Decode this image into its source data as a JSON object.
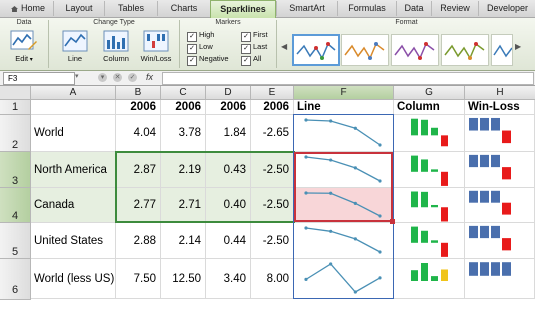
{
  "ribbon_tabs": [
    "Home",
    "Layout",
    "Tables",
    "Charts",
    "Sparklines",
    "SmartArt",
    "Formulas",
    "Data",
    "Review",
    "Developer"
  ],
  "active_tab": "Sparklines",
  "groups": {
    "data": {
      "title": "Data",
      "edit_label": "Edit"
    },
    "change_type": {
      "title": "Change Type",
      "line_label": "Line",
      "column_label": "Column",
      "winloss_label": "Win/Loss"
    },
    "markers": {
      "title": "Markers",
      "checks": [
        {
          "label": "High",
          "checked": true
        },
        {
          "label": "Low",
          "checked": true
        },
        {
          "label": "Negative",
          "checked": true
        },
        {
          "label": "First",
          "checked": true
        },
        {
          "label": "Last",
          "checked": true
        },
        {
          "label": "All",
          "checked": true
        }
      ]
    },
    "format": {
      "title": "Format"
    }
  },
  "formula_bar": {
    "cell_ref": "F3",
    "fx": "fx",
    "content": ""
  },
  "columns": [
    "A",
    "B",
    "C",
    "D",
    "E",
    "F",
    "G",
    "H"
  ],
  "selected_column": "F",
  "rows": [
    "1",
    "2",
    "3",
    "4",
    "5",
    "6"
  ],
  "selected_rows": [
    "3",
    "4"
  ],
  "header_row": {
    "a": "",
    "b": "2006",
    "c": "2006",
    "d": "2006",
    "e": "2006",
    "f": "Line",
    "g": "Column",
    "h": "Win-Loss"
  },
  "data_rows": [
    {
      "label": "World",
      "b": "4.04",
      "c": "3.78",
      "d": "1.84",
      "e": "-2.65"
    },
    {
      "label": "North America",
      "b": "2.87",
      "c": "2.19",
      "d": "0.43",
      "e": "-2.50"
    },
    {
      "label": "Canada",
      "b": "2.77",
      "c": "2.71",
      "d": "0.40",
      "e": "-2.50"
    },
    {
      "label": "United States",
      "b": "2.88",
      "c": "2.14",
      "d": "0.44",
      "e": "-2.50"
    },
    {
      "label": "World (less US)",
      "b": "7.50",
      "c": "12.50",
      "d": "3.40",
      "e": "8.00"
    }
  ],
  "sparkline_values": [
    [
      4.04,
      3.78,
      1.84,
      -2.65
    ],
    [
      2.87,
      2.19,
      0.43,
      -2.5
    ],
    [
      2.77,
      2.71,
      0.4,
      -2.5
    ],
    [
      2.88,
      2.14,
      0.44,
      -2.5
    ],
    [
      7.5,
      12.5,
      3.4,
      8.0
    ]
  ],
  "colors": {
    "line": "#4a90b5",
    "column_positive": "#1fb54a",
    "column_negative": "#e81a1a",
    "column_highlight": "#f0c419",
    "winloss_positive": "#4a6fad",
    "winloss_negative": "#e81a1a",
    "selection_green": "#3d8b3d",
    "selection_red": "#c8323c",
    "selection_blue": "#3b67b3"
  }
}
